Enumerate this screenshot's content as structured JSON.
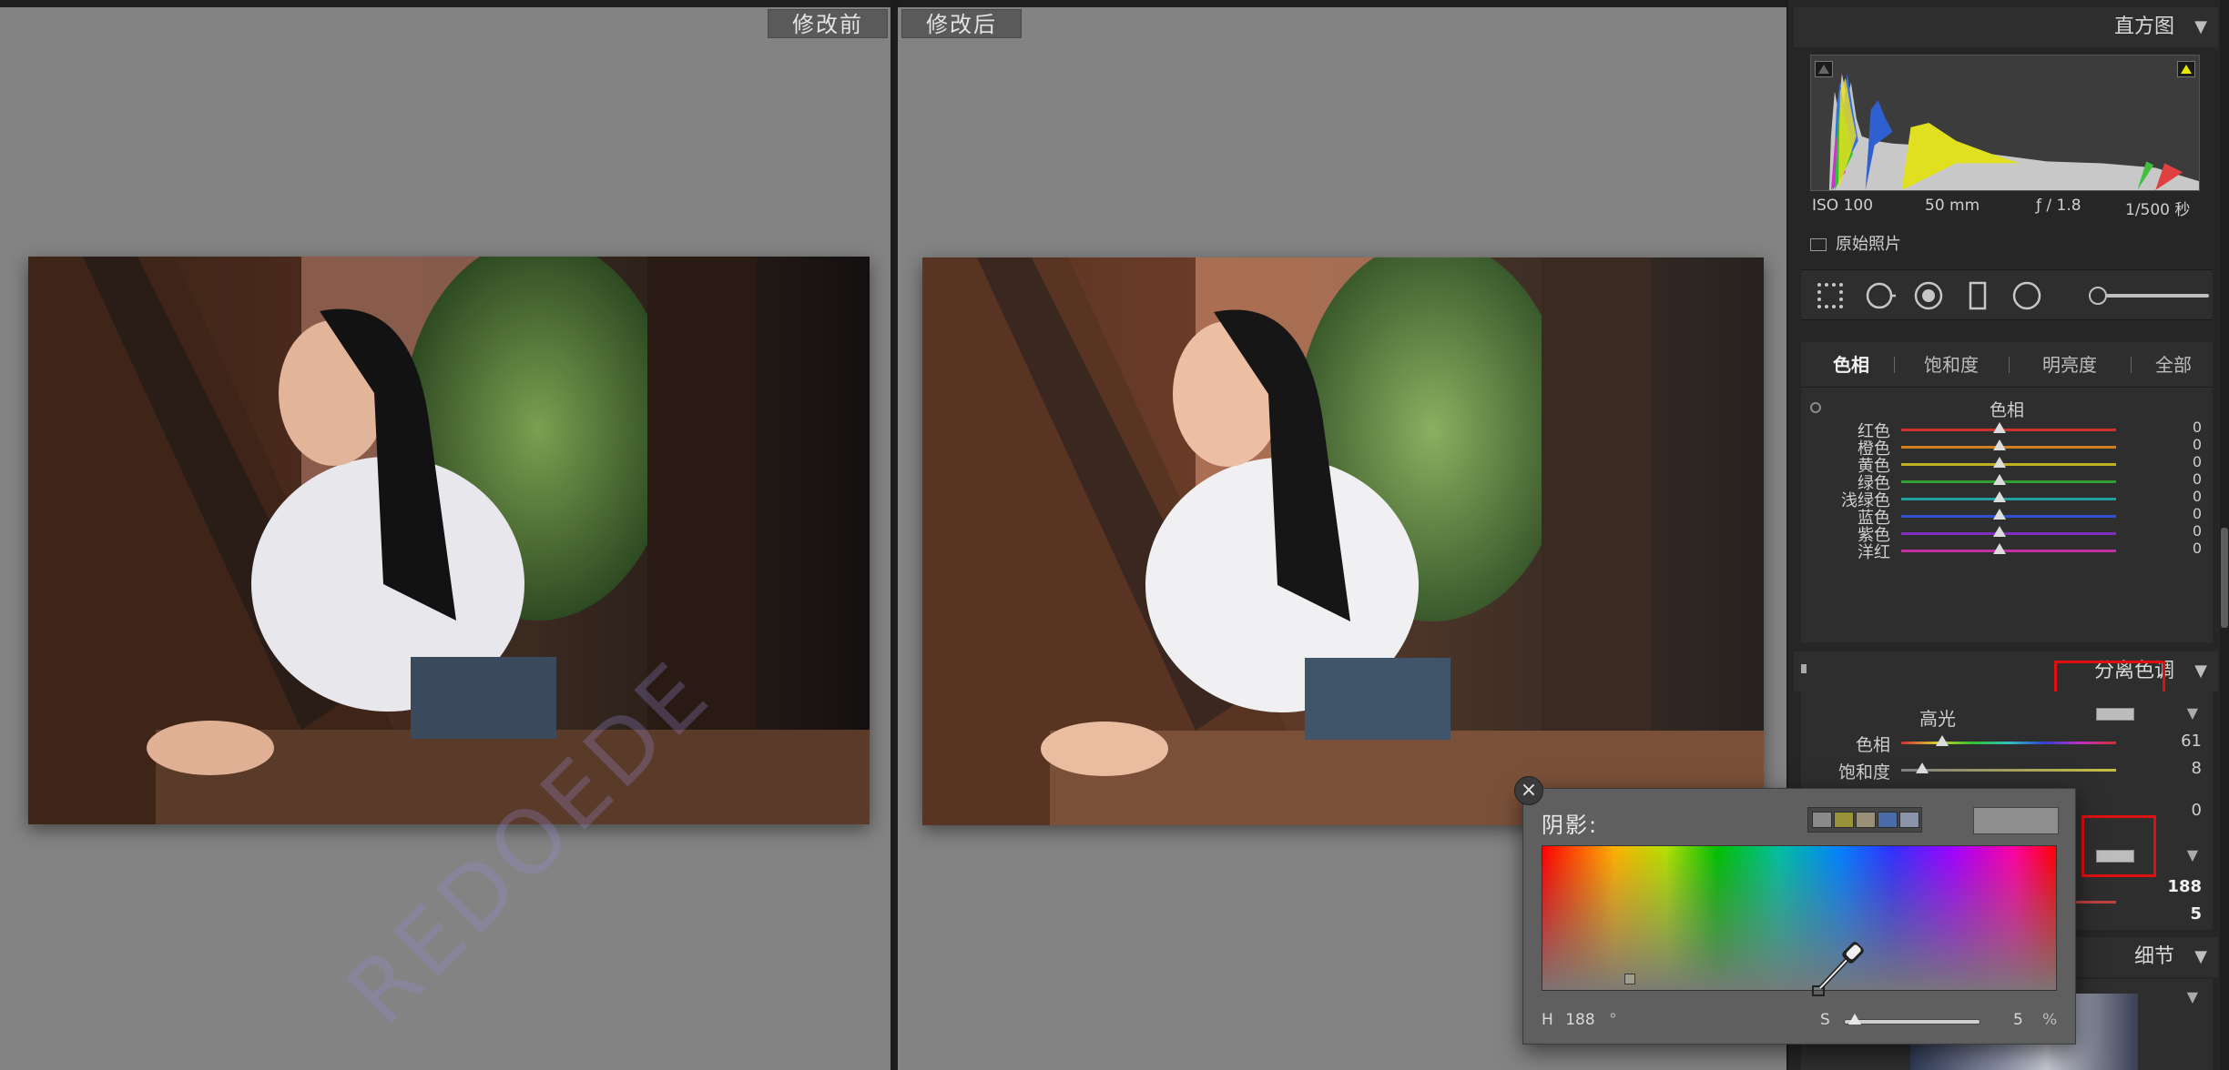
{
  "compare": {
    "before_label": "修改前",
    "after_label": "修改后",
    "watermark": "REDOEDE"
  },
  "panel": {
    "histogram_title": "直方图",
    "exif": {
      "iso": "ISO 100",
      "focal": "50 mm",
      "aperture": "ƒ / 1.8",
      "shutter": "1/500 秒"
    },
    "original_photo_label": "原始照片",
    "hsl": {
      "tabs": [
        "色相",
        "饱和度",
        "明亮度",
        "全部"
      ],
      "section_title": "色相",
      "rows": [
        {
          "label": "红色",
          "value": "0",
          "color": "#d03030"
        },
        {
          "label": "橙色",
          "value": "0",
          "color": "#d08020"
        },
        {
          "label": "黄色",
          "value": "0",
          "color": "#c0b020"
        },
        {
          "label": "绿色",
          "value": "0",
          "color": "#30a030"
        },
        {
          "label": "浅绿色",
          "value": "0",
          "color": "#20a0a0"
        },
        {
          "label": "蓝色",
          "value": "0",
          "color": "#3050d0"
        },
        {
          "label": "紫色",
          "value": "0",
          "color": "#8030c0"
        },
        {
          "label": "洋红",
          "value": "0",
          "color": "#c030a0"
        }
      ]
    },
    "split_toning": {
      "title": "分离色调",
      "highlights_title": "高光",
      "rows": [
        {
          "label": "色相",
          "value": "61"
        },
        {
          "label": "饱和度",
          "value": "8"
        }
      ],
      "balance_value": "0",
      "shadow_hue_value": "188",
      "shadow_sat_value": "5"
    },
    "detail_title": "细节"
  },
  "picker": {
    "title": "阴影:",
    "close_glyph": "×",
    "preset_colors": [
      "#8a8a8a",
      "#9a9238",
      "#9a9078",
      "#4a6aa8",
      "#8a94a8"
    ],
    "h_label": "H",
    "h_value": "188",
    "h_unit": "°",
    "s_label": "S",
    "s_value": "5",
    "s_unit": "%"
  },
  "colors": {
    "accent_red": "#e01010",
    "panel_bg": "#2e2e2e",
    "compare_bg": "#838383"
  }
}
